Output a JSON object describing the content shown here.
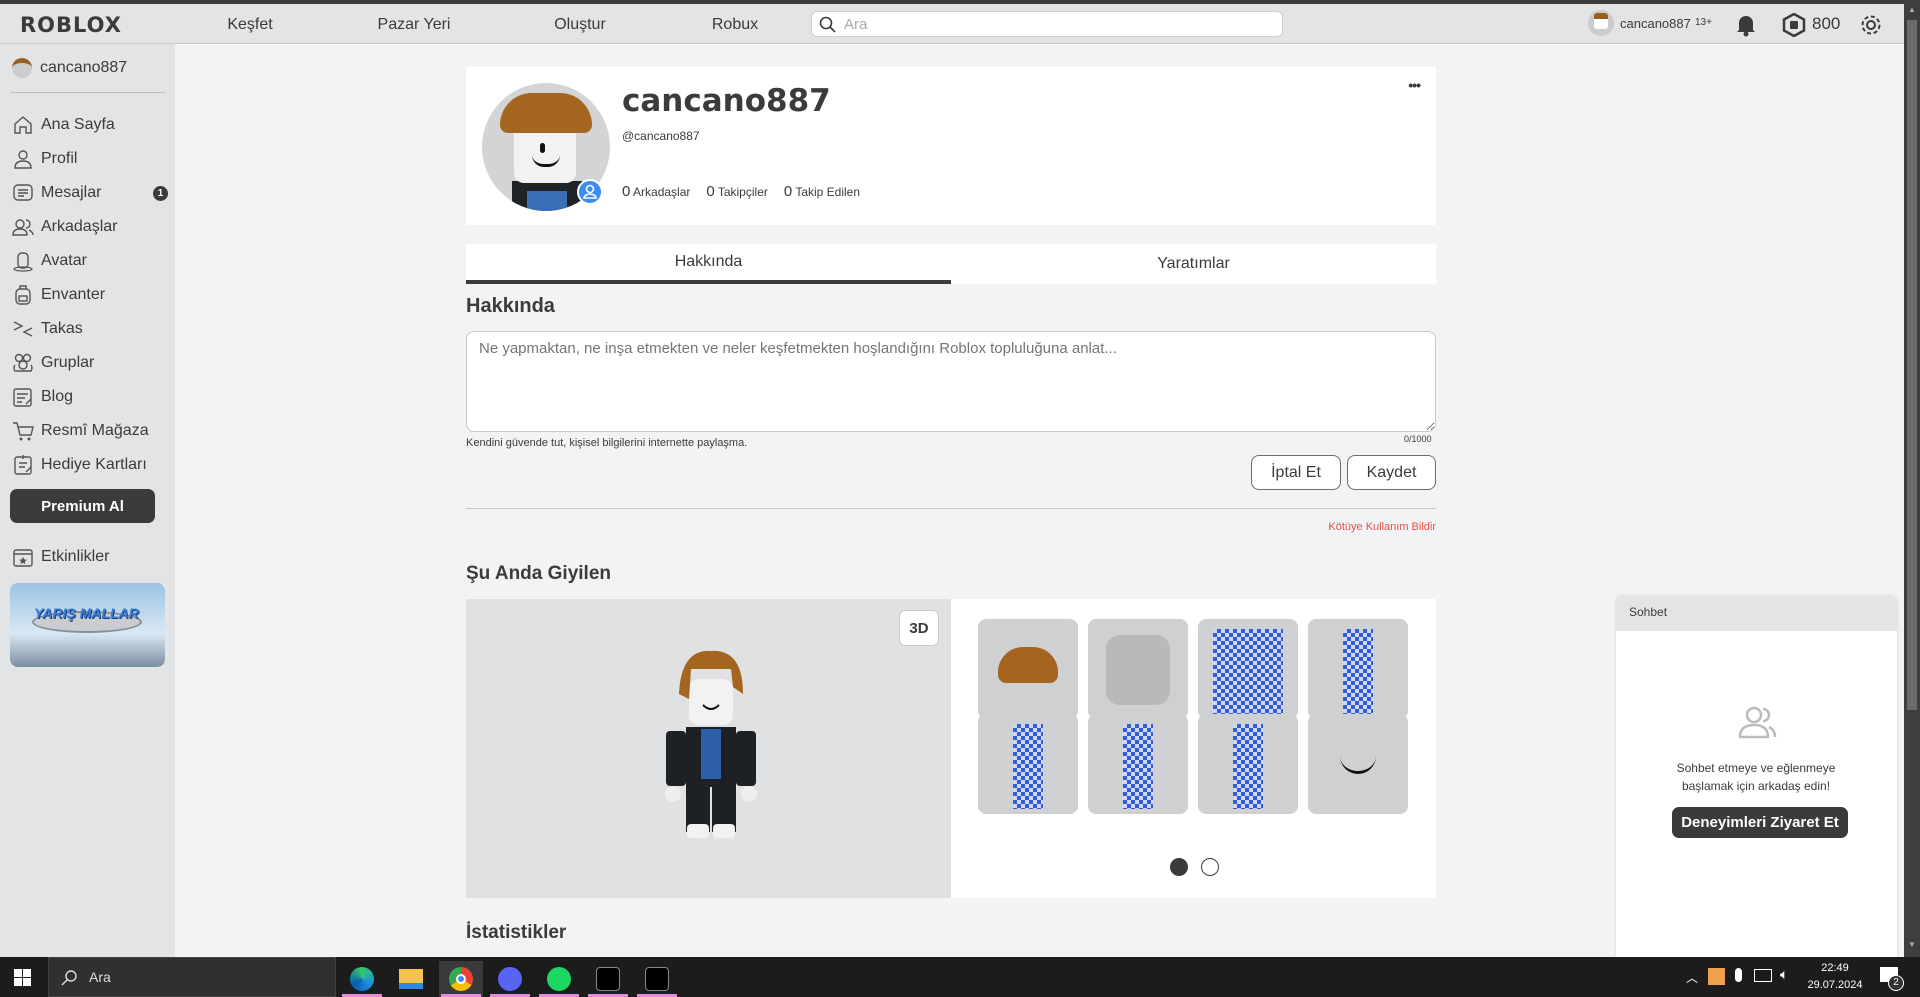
{
  "nav": {
    "logo": "ROBLOX",
    "links": [
      "Keşfet",
      "Pazar Yeri",
      "Oluştur",
      "Robux"
    ],
    "search_placeholder": "Ara",
    "username": "cancano887",
    "age_badge": "13+",
    "robux": "800"
  },
  "sidebar": {
    "username": "cancano887",
    "items": [
      {
        "label": "Ana Sayfa",
        "icon": "home-icon"
      },
      {
        "label": "Profil",
        "icon": "profile-icon"
      },
      {
        "label": "Mesajlar",
        "icon": "messages-icon",
        "badge": "1"
      },
      {
        "label": "Arkadaşlar",
        "icon": "friends-icon"
      },
      {
        "label": "Avatar",
        "icon": "avatar-icon"
      },
      {
        "label": "Envanter",
        "icon": "inventory-icon"
      },
      {
        "label": "Takas",
        "icon": "trade-icon"
      },
      {
        "label": "Gruplar",
        "icon": "groups-icon"
      },
      {
        "label": "Blog",
        "icon": "blog-icon"
      },
      {
        "label": "Resmî Mağaza",
        "icon": "store-icon"
      },
      {
        "label": "Hediye Kartları",
        "icon": "gift-card-icon"
      }
    ],
    "premium": "Premium Al",
    "events": "Etkinlikler",
    "banner_text": "YARIŞ MALLAR"
  },
  "profile": {
    "display_name": "cancano887",
    "handle": "@cancano887",
    "stats": [
      {
        "count": "0",
        "label": "Arkadaşlar"
      },
      {
        "count": "0",
        "label": "Takipçiler"
      },
      {
        "count": "0",
        "label": "Takip Edilen"
      }
    ]
  },
  "tabs": [
    "Hakkında",
    "Yaratımlar"
  ],
  "about": {
    "heading": "Hakkında",
    "placeholder": "Ne yapmaktan, ne inşa etmekten ve neler keşfetmekten hoşlandığını Roblox topluluğuna anlat...",
    "hint": "Kendini güvende tut, kişisel bilgilerini internette paylaşma.",
    "counter": "0/1000",
    "cancel": "İptal Et",
    "save": "Kaydet",
    "report": "Kötüye Kullanım Bildir"
  },
  "wearing": {
    "heading": "Şu Anda Giyilen",
    "toggle": "3D",
    "page": 1,
    "pages": 2
  },
  "stats_heading": "İstatistikler",
  "chat": {
    "title": "Sohbet",
    "message": "Sohbet etmeye ve eğlenmeye başlamak için arkadaş edin!",
    "button": "Deneyimleri Ziyaret Et"
  },
  "taskbar": {
    "search": "Ara",
    "time": "22:49",
    "date": "29.07.2024",
    "notifications": "2"
  },
  "colors": {
    "accent_dark": "#393b3d",
    "report": "#e2514a",
    "verified": "#3b8cf6"
  }
}
